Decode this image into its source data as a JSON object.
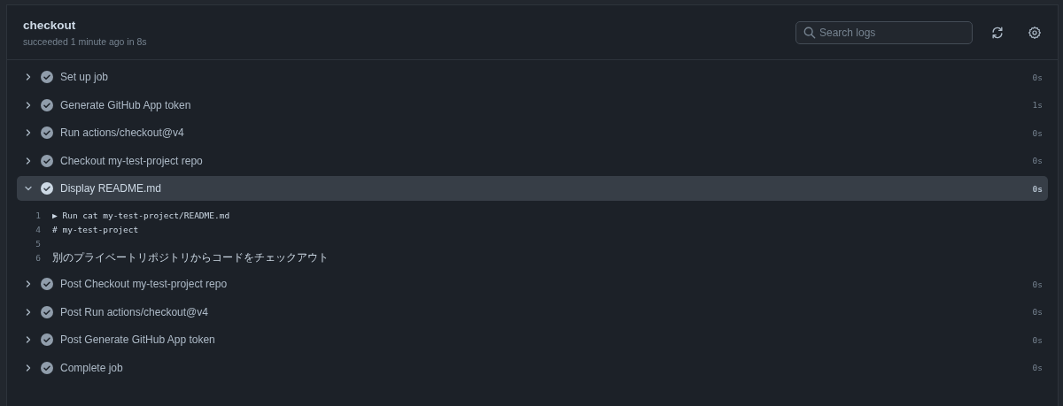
{
  "job": {
    "title": "checkout",
    "summary": "succeeded 1 minute ago in 8s"
  },
  "search": {
    "placeholder": "Search logs"
  },
  "steps": [
    {
      "label": "Set up job",
      "duration": "0s",
      "expanded": false
    },
    {
      "label": "Generate GitHub App token",
      "duration": "1s",
      "expanded": false
    },
    {
      "label": "Run actions/checkout@v4",
      "duration": "0s",
      "expanded": false
    },
    {
      "label": "Checkout my-test-project repo",
      "duration": "0s",
      "expanded": false
    },
    {
      "label": "Display README.md",
      "duration": "0s",
      "expanded": true,
      "log": [
        {
          "number": "1",
          "text": "▶ Run cat my-test-project/README.md"
        },
        {
          "number": "4",
          "text": "# my-test-project"
        },
        {
          "number": "5"
        },
        {
          "number": "6",
          "text": "別のプライベートリポジトリからコードをチェックアウト"
        }
      ]
    },
    {
      "label": "Post Checkout my-test-project repo",
      "duration": "0s",
      "expanded": false
    },
    {
      "label": "Post Run actions/checkout@v4",
      "duration": "0s",
      "expanded": false
    },
    {
      "label": "Post Generate GitHub App token",
      "duration": "0s",
      "expanded": false
    },
    {
      "label": "Complete job",
      "duration": "0s",
      "expanded": false
    }
  ]
}
